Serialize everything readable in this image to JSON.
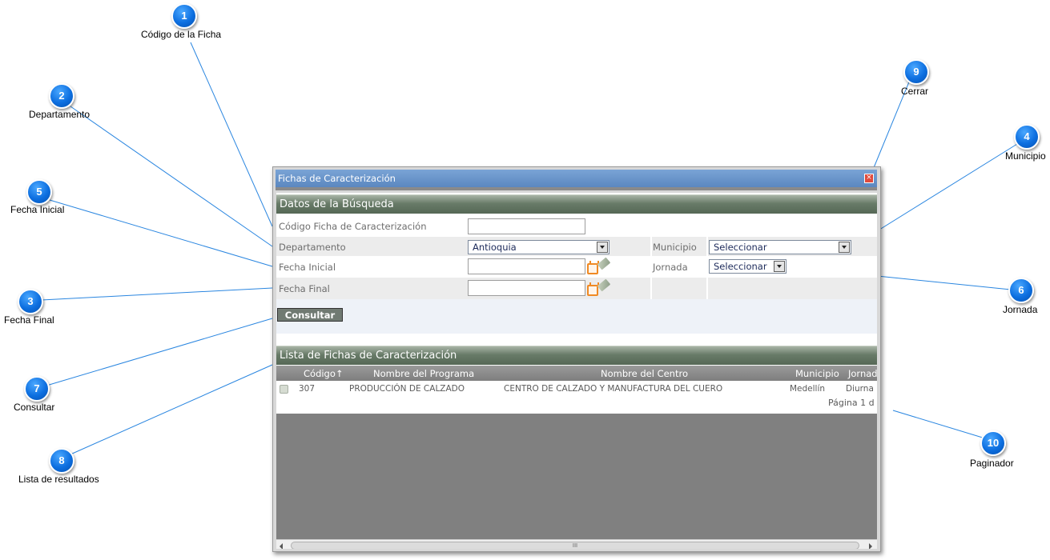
{
  "window": {
    "title": "Fichas de Caracterización",
    "close_glyph": "×"
  },
  "search": {
    "section_title": "Datos de la Búsqueda",
    "codigo_label": "Código Ficha de Caracterización",
    "codigo_value": "",
    "departamento_label": "Departamento",
    "departamento_value": "Antioquia",
    "municipio_label": "Municipio",
    "municipio_value": "Seleccionar",
    "fecha_inicial_label": "Fecha Inicial",
    "fecha_inicial_value": "",
    "jornada_label": "Jornada",
    "jornada_value": "Seleccionar",
    "fecha_final_label": "Fecha Final",
    "fecha_final_value": "",
    "consultar_label": "Consultar"
  },
  "results": {
    "section_title": "Lista de Fichas de Caracterización",
    "columns": [
      "Código↑",
      "Nombre del Programa",
      "Nombre del Centro",
      "Municipio",
      "Jornad"
    ],
    "rows": [
      {
        "codigo": "307",
        "programa": "PRODUCCIÓN DE CALZADO",
        "centro": "CENTRO DE CALZADO Y MANUFACTURA DEL CUERO",
        "municipio": "Medellín",
        "jornada": "Diurna"
      }
    ],
    "pagination": "Página 1 d",
    "scroll_grip": "III"
  },
  "callouts": [
    {
      "num": "1",
      "label": "Código de la Ficha"
    },
    {
      "num": "2",
      "label": "Departamento"
    },
    {
      "num": "5",
      "label": "Fecha Inicial"
    },
    {
      "num": "3",
      "label": "Fecha Final"
    },
    {
      "num": "7",
      "label": "Consultar"
    },
    {
      "num": "8",
      "label": "Lista de resultados"
    },
    {
      "num": "9",
      "label": "Cerrar"
    },
    {
      "num": "4",
      "label": "Municipio"
    },
    {
      "num": "6",
      "label": "Jornada"
    },
    {
      "num": "10",
      "label": "Paginador"
    }
  ],
  "colors": {
    "titlebar": "#6b96cc",
    "section_header": "#5f735f",
    "callout_blue": "#0d6fe0",
    "callout_line": "#2a86e0",
    "empty_area": "#808080"
  }
}
